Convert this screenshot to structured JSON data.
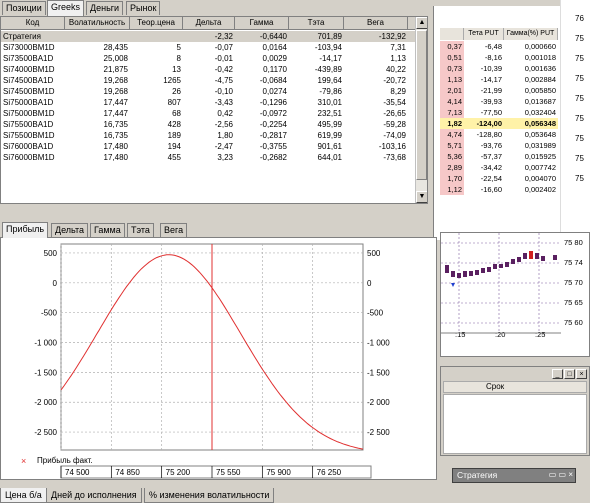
{
  "top_tabs": [
    "Позиции",
    "Greeks",
    "Деньги",
    "Рынок"
  ],
  "greeks": {
    "columns": [
      "Код",
      "Волатильность",
      "Теор.цена",
      "Дельта",
      "Гамма",
      "Тэта",
      "Вега"
    ],
    "strategy": {
      "code": "Стратегия",
      "vol": "",
      "price": "",
      "delta": "-2,32",
      "gamma": "-0,6440",
      "theta": "701,89",
      "vega": "-132,92"
    },
    "rows": [
      {
        "code": "Si73000BM1D",
        "vol": "28,435",
        "price": "5",
        "delta": "-0,07",
        "gamma": "0,0164",
        "theta": "-103,94",
        "vega": "7,31"
      },
      {
        "code": "Si73500BA1D",
        "vol": "25,008",
        "price": "8",
        "delta": "-0,01",
        "gamma": "0,0029",
        "theta": "-14,17",
        "vega": "1,13"
      },
      {
        "code": "Si74000BM1D",
        "vol": "21,875",
        "price": "13",
        "delta": "-0,42",
        "gamma": "0,1170",
        "theta": "-439,89",
        "vega": "40,22"
      },
      {
        "code": "Si74500BA1D",
        "vol": "19,268",
        "price": "1265",
        "delta": "-4,75",
        "gamma": "-0,0684",
        "theta": "199,64",
        "vega": "-20,72"
      },
      {
        "code": "Si74500BM1D",
        "vol": "19,268",
        "price": "26",
        "delta": "-0,10",
        "gamma": "0,0274",
        "theta": "-79,86",
        "vega": "8,29"
      },
      {
        "code": "Si75000BA1D",
        "vol": "17,447",
        "price": "807",
        "delta": "-3,43",
        "gamma": "-0,1296",
        "theta": "310,01",
        "vega": "-35,54"
      },
      {
        "code": "Si75000BM1D",
        "vol": "17,447",
        "price": "68",
        "delta": "0,42",
        "gamma": "-0,0972",
        "theta": "232,51",
        "vega": "-26,65"
      },
      {
        "code": "Si75500BA1D",
        "vol": "16,735",
        "price": "428",
        "delta": "-2,56",
        "gamma": "-0,2254",
        "theta": "495,99",
        "vega": "-59,28"
      },
      {
        "code": "Si75500BM1D",
        "vol": "16,735",
        "price": "189",
        "delta": "1,80",
        "gamma": "-0,2817",
        "theta": "619,99",
        "vega": "-74,09"
      },
      {
        "code": "Si76000BA1D",
        "vol": "17,480",
        "price": "194",
        "delta": "-2,47",
        "gamma": "-0,3755",
        "theta": "901,61",
        "vega": "-103,16"
      },
      {
        "code": "Si76000BM1D",
        "vol": "17,480",
        "price": "455",
        "delta": "3,23",
        "gamma": "-0,2682",
        "theta": "644,01",
        "vega": "-73,68"
      }
    ]
  },
  "chart_tabs": [
    "Прибыль",
    "Дельта",
    "Гамма",
    "Тэта",
    "Вега"
  ],
  "bottom_tabs": [
    "Цена б/а",
    "Дней до исполнения",
    "% изменения волатильности"
  ],
  "chart_data": {
    "type": "line",
    "series": [
      {
        "name": "Прибыль факт.",
        "color": "#e03030"
      }
    ],
    "x_ticks": [
      "74 500",
      "74 850",
      "75 200",
      "75 550",
      "75 900",
      "76 250"
    ],
    "y_ticks": [
      "500",
      "0",
      "-500",
      "-1 000",
      "-1 500",
      "-2 000",
      "-2 500"
    ],
    "xlim": [
      74500,
      76600
    ],
    "ylim": [
      -2800,
      650
    ],
    "peak_x": 75250,
    "peak_y": 470,
    "vertical_marker_x": 75550,
    "legend": "bottom-left",
    "grid": true
  },
  "right_panel": {
    "headers": [
      "Тета PUT",
      "Гамма(%) PUT"
    ],
    "price_col": [
      "0,37",
      "0,51",
      "0,73",
      "1,13",
      "2,01",
      "4,14",
      "7,13",
      "1,82",
      "4,74",
      "5,71",
      "5,36",
      "2,89",
      "1,70",
      "1,12"
    ],
    "theta_col": [
      "-6,48",
      "-8,16",
      "-10,39",
      "-14,17",
      "-21,99",
      "-39,93",
      "-77,50",
      "-124,00",
      "-128,80",
      "-93,76",
      "-57,37",
      "-34,42",
      "-22,54",
      "-16,60"
    ],
    "gamma_col": [
      "0,000660",
      "0,001018",
      "0,001636",
      "0,002884",
      "0,005850",
      "0,013687",
      "0,032404",
      "0,056348",
      "0,053648",
      "0,031989",
      "0,015925",
      "0,007742",
      "0,004070",
      "0,002402"
    ],
    "price_scale": [
      "76",
      "75",
      "75",
      "75",
      "75",
      "75",
      "75",
      "75",
      "75"
    ],
    "chart_prices": [
      "75 80",
      "75 74",
      "75 70",
      "75 65",
      "75 60"
    ],
    "time_labels": [
      ":15",
      ":20",
      ":25"
    ],
    "term_header": "Срок",
    "bottom_window_title": "Стратегия"
  }
}
